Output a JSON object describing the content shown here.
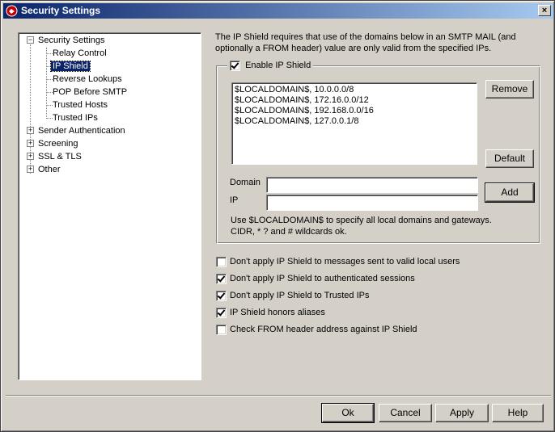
{
  "window": {
    "title": "Security Settings",
    "close_label": "×"
  },
  "tree": {
    "items": [
      {
        "label": "Security Settings",
        "expander": "−"
      },
      {
        "label": "Relay Control"
      },
      {
        "label": "IP Shield",
        "selected": true
      },
      {
        "label": "Reverse Lookups"
      },
      {
        "label": "POP Before SMTP"
      },
      {
        "label": "Trusted Hosts"
      },
      {
        "label": "Trusted IPs"
      },
      {
        "label": "Sender Authentication",
        "expander": "+"
      },
      {
        "label": "Screening",
        "expander": "+"
      },
      {
        "label": "SSL & TLS",
        "expander": "+"
      },
      {
        "label": "Other",
        "expander": "+"
      }
    ]
  },
  "main": {
    "description": "The IP Shield requires that use of the domains below in an SMTP MAIL (and optionally a FROM header) value are only valid from the specified IPs.",
    "enable_label": "Enable IP Shield",
    "enable_checked": true,
    "list_entries": [
      "$LOCALDOMAIN$, 10.0.0.0/8",
      "$LOCALDOMAIN$, 172.16.0.0/12",
      "$LOCALDOMAIN$, 192.168.0.0/16",
      "$LOCALDOMAIN$, 127.0.0.1/8"
    ],
    "remove_label": "Remove",
    "default_label": "Default",
    "domain_label": "Domain",
    "domain_value": "",
    "ip_label": "IP",
    "ip_value": "",
    "add_label": "Add",
    "hint_line1": "Use $LOCALDOMAIN$ to specify all local domains and gateways.",
    "hint_line2": "CIDR, * ? and # wildcards ok.",
    "options": [
      {
        "label": "Don't apply IP Shield to messages sent to valid local users",
        "checked": false
      },
      {
        "label": "Don't apply IP Shield to authenticated sessions",
        "checked": true
      },
      {
        "label": "Don't apply IP Shield to Trusted IPs",
        "checked": true
      },
      {
        "label": "IP Shield honors aliases",
        "checked": true
      },
      {
        "label": "Check FROM header address against IP Shield",
        "checked": false
      }
    ]
  },
  "footer": {
    "ok_label": "Ok",
    "cancel_label": "Cancel",
    "apply_label": "Apply",
    "help_label": "Help"
  }
}
